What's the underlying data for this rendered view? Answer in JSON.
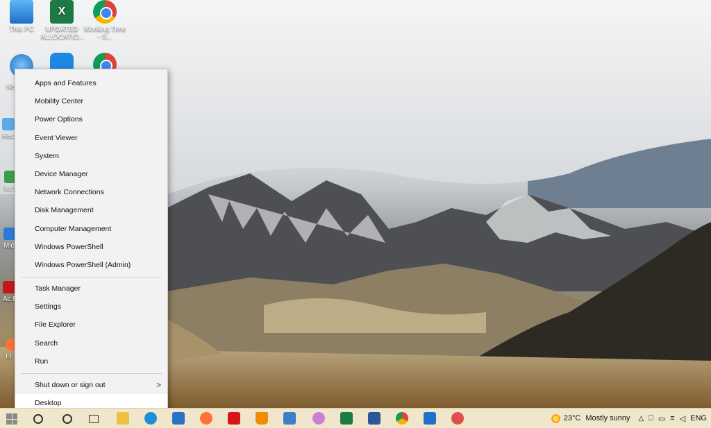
{
  "desktop": {
    "icons": [
      {
        "label": "This PC",
        "kind": "pc"
      },
      {
        "label": "UPDATED ALLOCATIO...",
        "kind": "xl"
      },
      {
        "label": "Working Time - S...",
        "kind": "chrome"
      }
    ],
    "edge_labels": [
      "Ne",
      "Rec",
      "Int Do",
      "Mic E",
      "Ac Rea",
      "Fi"
    ]
  },
  "context_menu": {
    "group1": [
      "Apps and Features",
      "Mobility Center",
      "Power Options",
      "Event Viewer",
      "System",
      "Device Manager",
      "Network Connections",
      "Disk Management",
      "Computer Management",
      "Windows PowerShell",
      "Windows PowerShell (Admin)"
    ],
    "group2": [
      "Task Manager",
      "Settings",
      "File Explorer",
      "Search",
      "Run"
    ],
    "group3": [
      "Shut down or sign out",
      "Desktop"
    ],
    "submenu_chevron": ">"
  },
  "taskbar": {
    "weather_temp": "23°C",
    "weather_desc": "Mostly sunny",
    "language": "ENG",
    "apps": [
      "task-view",
      "folder",
      "edge",
      "mail",
      "firefox",
      "acrobat",
      "vlc",
      "snipping",
      "paint",
      "excel",
      "word",
      "chrome",
      "photos",
      "paint-3d"
    ],
    "colors": {
      "taskbar": "#f0e6cc"
    }
  }
}
